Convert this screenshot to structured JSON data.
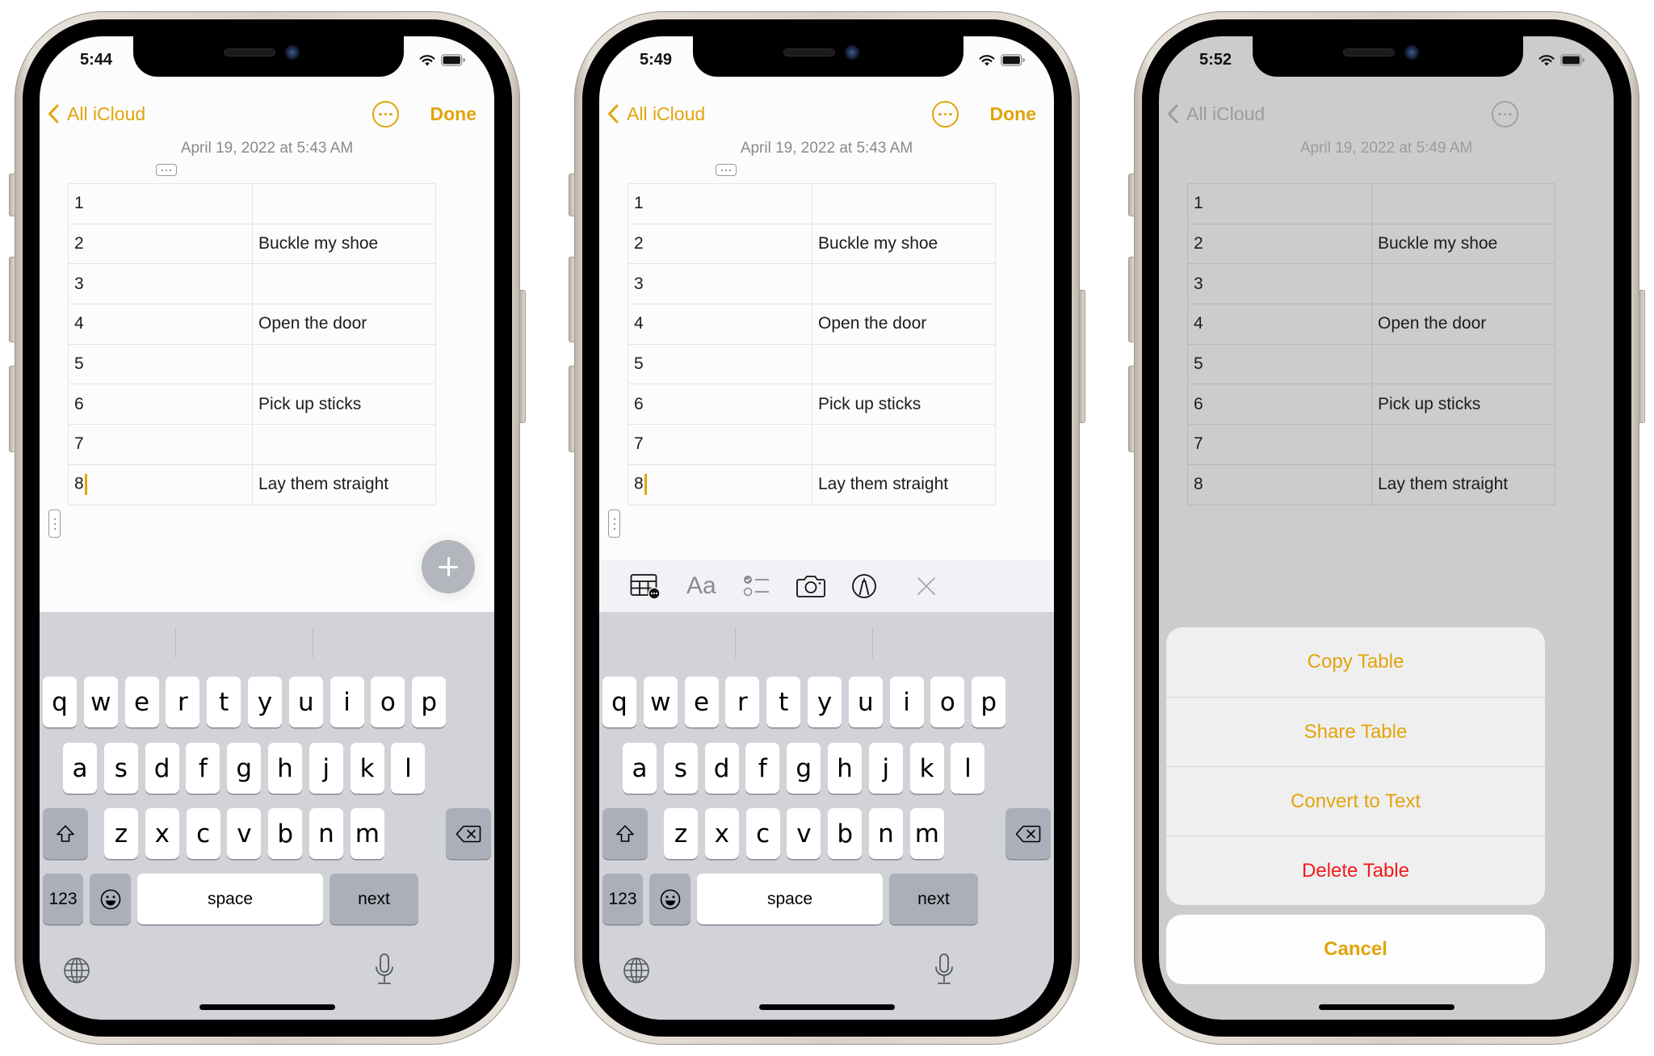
{
  "phones": [
    {
      "status_time": "5:44",
      "nav": {
        "back_label": "All iCloud",
        "done_label": "Done"
      },
      "note_date": "April 19, 2022 at 5:43 AM",
      "table_rows": [
        [
          "1",
          ""
        ],
        [
          "2",
          "Buckle my shoe"
        ],
        [
          "3",
          ""
        ],
        [
          "4",
          "Open the door"
        ],
        [
          "5",
          ""
        ],
        [
          "6",
          "Pick up sticks"
        ],
        [
          "7",
          ""
        ],
        [
          "8",
          "Lay them straight"
        ]
      ],
      "keyboard": {
        "row1": [
          "q",
          "w",
          "e",
          "r",
          "t",
          "y",
          "u",
          "i",
          "o",
          "p"
        ],
        "row2": [
          "a",
          "s",
          "d",
          "f",
          "g",
          "h",
          "j",
          "k",
          "l"
        ],
        "row3": [
          "z",
          "x",
          "c",
          "v",
          "b",
          "n",
          "m"
        ],
        "numbers_label": "123",
        "space_label": "space",
        "return_label": "next"
      }
    },
    {
      "status_time": "5:49",
      "nav": {
        "back_label": "All iCloud",
        "done_label": "Done"
      },
      "note_date": "April 19, 2022 at 5:43 AM",
      "table_rows": [
        [
          "1",
          ""
        ],
        [
          "2",
          "Buckle my shoe"
        ],
        [
          "3",
          ""
        ],
        [
          "4",
          "Open the door"
        ],
        [
          "5",
          ""
        ],
        [
          "6",
          "Pick up sticks"
        ],
        [
          "7",
          ""
        ],
        [
          "8",
          "Lay them straight"
        ]
      ],
      "toolbar": {
        "icons": [
          "table-icon",
          "text-format-icon",
          "checklist-icon",
          "camera-icon",
          "markup-icon",
          "close-icon"
        ],
        "format_label": "Aa"
      },
      "keyboard": {
        "row1": [
          "q",
          "w",
          "e",
          "r",
          "t",
          "y",
          "u",
          "i",
          "o",
          "p"
        ],
        "row2": [
          "a",
          "s",
          "d",
          "f",
          "g",
          "h",
          "j",
          "k",
          "l"
        ],
        "row3": [
          "z",
          "x",
          "c",
          "v",
          "b",
          "n",
          "m"
        ],
        "numbers_label": "123",
        "space_label": "space",
        "return_label": "next"
      }
    },
    {
      "status_time": "5:52",
      "nav": {
        "back_label": "All iCloud"
      },
      "note_date": "April 19, 2022 at 5:49 AM",
      "table_rows": [
        [
          "1",
          ""
        ],
        [
          "2",
          "Buckle my shoe"
        ],
        [
          "3",
          ""
        ],
        [
          "4",
          "Open the door"
        ],
        [
          "5",
          ""
        ],
        [
          "6",
          "Pick up sticks"
        ],
        [
          "7",
          ""
        ],
        [
          "8",
          "Lay them straight"
        ]
      ],
      "action_sheet": {
        "items": [
          {
            "label": "Copy Table",
            "style": "default"
          },
          {
            "label": "Share Table",
            "style": "default"
          },
          {
            "label": "Convert to Text",
            "style": "default"
          },
          {
            "label": "Delete Table",
            "style": "destructive"
          }
        ],
        "cancel_label": "Cancel"
      }
    }
  ],
  "colors": {
    "accent": "#e2a40a",
    "destructive": "#f21b1b",
    "keyboard_bg": "#d1d3d9",
    "dim_overlay": "#cccccc"
  }
}
